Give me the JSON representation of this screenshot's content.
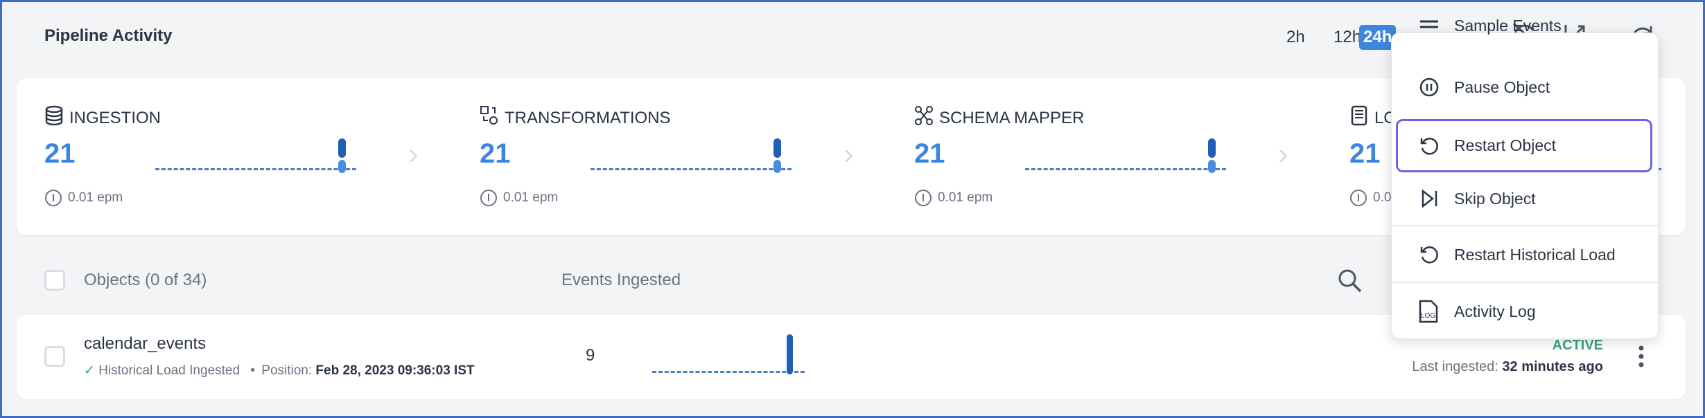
{
  "header": {
    "title": "Pipeline Activity",
    "time_ranges": [
      "2h",
      "12h",
      "24h"
    ],
    "selected_range": "24h"
  },
  "stages": [
    {
      "label": "INGESTION",
      "icon": "database-icon",
      "count": "21",
      "rate": "0.01 epm"
    },
    {
      "label": "TRANSFORMATIONS",
      "icon": "transformations-icon",
      "count": "21",
      "rate": "0.01 epm"
    },
    {
      "label": "SCHEMA MAPPER",
      "icon": "schema-mapper-icon",
      "count": "21",
      "rate": "0.01 epm"
    },
    {
      "label": "LO",
      "icon": "loader-icon",
      "count": "21",
      "rate": "0.0"
    }
  ],
  "objects": {
    "header_label": "Objects (0 of 34)",
    "events_header": "Events Ingested"
  },
  "rows": [
    {
      "name": "calendar_events",
      "load_status": "Historical Load Ingested",
      "position_label": "Position:",
      "position_value": "Feb 28, 2023 09:36:03 IST",
      "events": "9",
      "status": "ACTIVE",
      "last_label": "Last ingested:",
      "last_value": "32 minutes ago"
    }
  ],
  "menu": {
    "items": [
      "Sample Events",
      "Pause Object",
      "Restart Object",
      "Skip Object",
      "Restart Historical Load",
      "Activity Log"
    ],
    "highlighted": "Restart Object"
  },
  "colors": {
    "accent": "#3d86dd",
    "active": "#3aa57a",
    "highlight": "#6b63e6"
  }
}
